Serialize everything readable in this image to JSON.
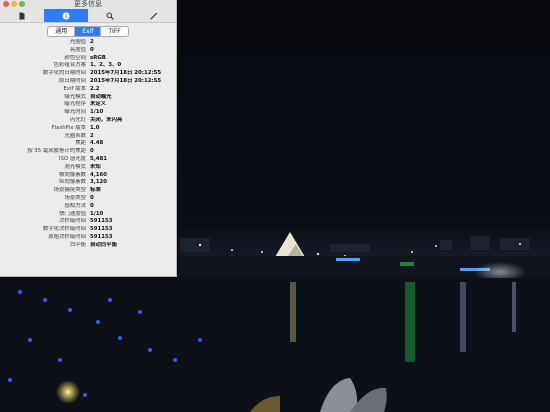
{
  "window": {
    "title": "更多信息"
  },
  "toolbar": {
    "tabs": [
      {
        "icon": "document-icon",
        "active": false
      },
      {
        "icon": "info-icon",
        "active": true
      },
      {
        "icon": "magnifier-icon",
        "active": false
      },
      {
        "icon": "pen-icon",
        "active": false
      }
    ]
  },
  "segments": {
    "general": "通用",
    "exif": "Exif",
    "tiff": "TIFF",
    "active": "exif"
  },
  "exif": [
    {
      "label": "光圈值",
      "value": "2"
    },
    {
      "label": "亮度值",
      "value": "0"
    },
    {
      "label": "颜色空间",
      "value": "sRGB"
    },
    {
      "label": "色彩组合方案",
      "value": "1、2、3、0"
    },
    {
      "label": "数字化的日期时间",
      "value": "2015年7月18日 20:12:55"
    },
    {
      "label": "原日期时间",
      "value": "2015年7月18日 20:12:55"
    },
    {
      "label": "Exif 版本",
      "value": "2.2"
    },
    {
      "label": "曝光模式",
      "value": "自动曝光"
    },
    {
      "label": "曝光程序",
      "value": "未定义"
    },
    {
      "label": "曝光时间",
      "value": "1/10"
    },
    {
      "label": "闪光灯",
      "value": "关闭，未闪亮"
    },
    {
      "label": "FlashPix 版本",
      "value": "1.0"
    },
    {
      "label": "光圈系数",
      "value": "2"
    },
    {
      "label": "焦距",
      "value": "4.48"
    },
    {
      "label": "按 35 毫米胶卷计的焦距",
      "value": "0"
    },
    {
      "label": "ISO 感光度",
      "value": "5,481"
    },
    {
      "label": "测光模式",
      "value": "未知"
    },
    {
      "label": "横向像素数",
      "value": "4,160"
    },
    {
      "label": "纵向像素数",
      "value": "3,120"
    },
    {
      "label": "场景捕捉类型",
      "value": "标准"
    },
    {
      "label": "场景类型",
      "value": "0"
    },
    {
      "label": "感知方法",
      "value": "0"
    },
    {
      "label": "快门速度值",
      "value": "1/10"
    },
    {
      "label": "次秒级时间",
      "value": "591153"
    },
    {
      "label": "数字化次秒级时间",
      "value": "591153"
    },
    {
      "label": "原始次秒级时间",
      "value": "591153"
    },
    {
      "label": "白平衡",
      "value": "自动白平衡"
    }
  ],
  "colors": {
    "accent": "#2f7cf6",
    "panel": "#ececec"
  }
}
